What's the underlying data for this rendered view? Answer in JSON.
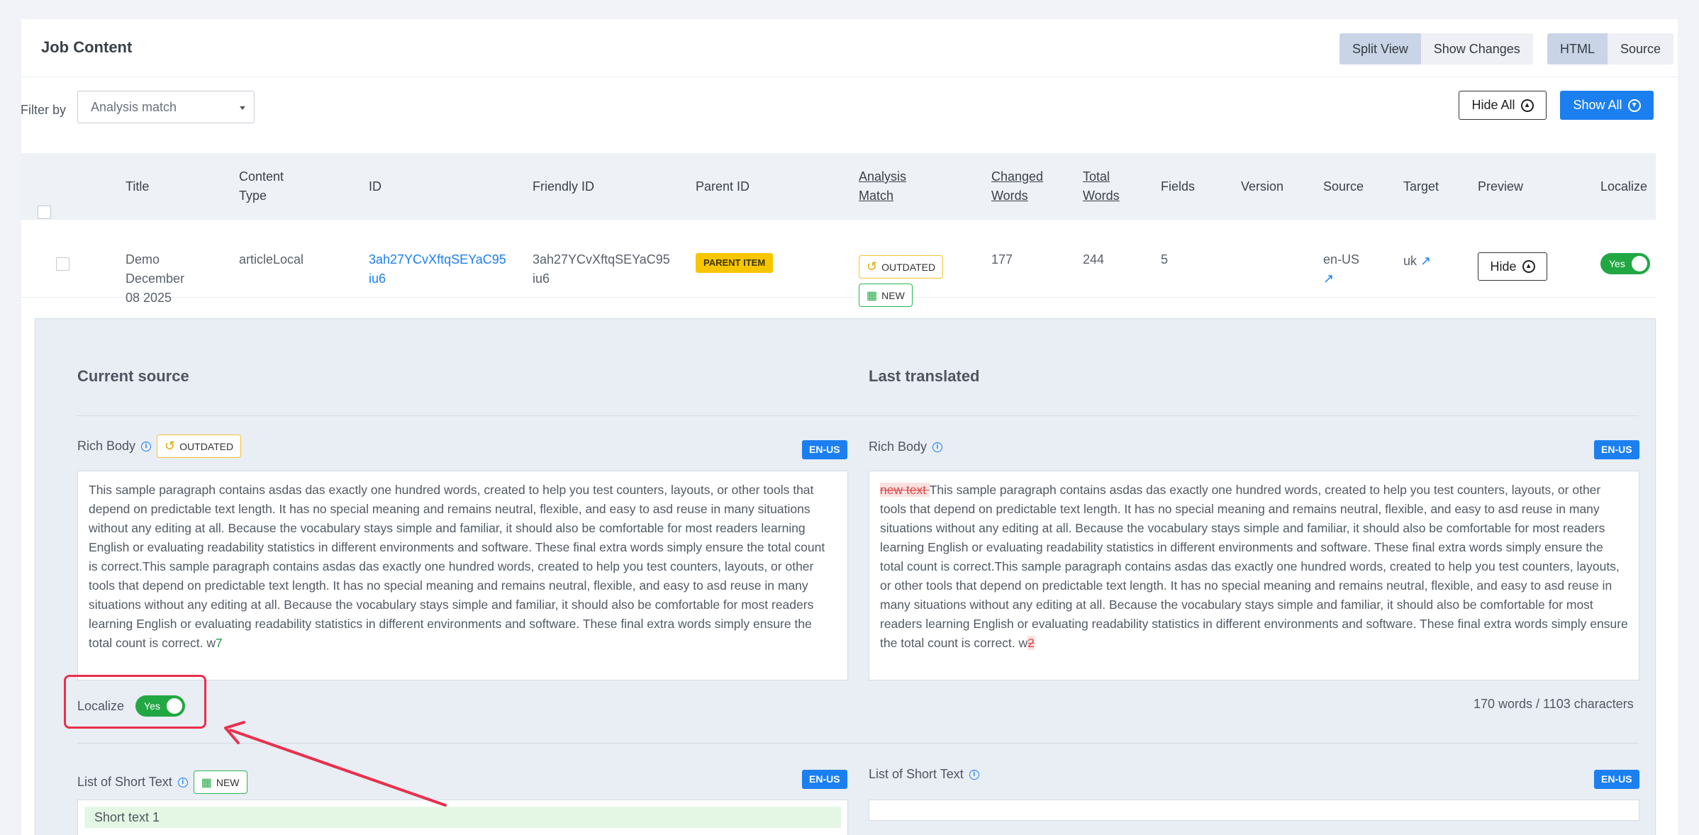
{
  "header": {
    "title": "Job Content",
    "view_options": [
      "Split View",
      "Show Changes"
    ],
    "mode_options": [
      "HTML",
      "Source"
    ]
  },
  "filter": {
    "label": "Filter by",
    "selected": "Analysis match",
    "hide_all": "Hide All",
    "show_all": "Show All"
  },
  "table": {
    "columns": [
      "Title",
      "Content Type",
      "ID",
      "Friendly ID",
      "Parent ID",
      "Analysis Match",
      "Changed Words",
      "Total Words",
      "Fields",
      "Version",
      "Source",
      "Target",
      "Preview",
      "Localize"
    ],
    "row": {
      "title": "Demo December 08 2025",
      "content_type": "articleLocal",
      "id": "3ah27YCvXftqSEYaC95iu6",
      "friendly_id": "3ah27YCvXftqSEYaC95iu6",
      "parent_badge": "PARENT ITEM",
      "badge_outdated": "OUTDATED",
      "badge_new": "NEW",
      "changed_words": "177",
      "total_words": "244",
      "fields": "5",
      "version": "",
      "source": "en-US",
      "target": "uk",
      "preview_button": "Hide",
      "localize_toggle": "Yes"
    }
  },
  "panel": {
    "current_source_title": "Current source",
    "last_translated_title": "Last translated",
    "rich_body": {
      "label": "Rich Body",
      "badge": "OUTDATED",
      "lang": "EN-US",
      "source_text": "This sample paragraph contains asdas das exactly one hundred words, created to help you test counters, layouts, or other tools that depend on predictable text length. It has no special meaning and remains neutral, flexible, and easy to asd reuse in many situations without any editing at all. Because the vocabulary stays simple and familiar, it should also be comfortable for most readers learning English or evaluating readability statistics in different environments and software. These final extra words simply ensure the total count is correct.This sample paragraph contains asdas das exactly one hundred words, created to help you test counters, layouts, or other tools that depend on predictable text length. It has no special meaning and remains neutral, flexible, and easy to asd reuse in many situations without any editing at all. Because the vocabulary stays simple and familiar, it should also be comfortable for most readers learning English or evaluating readability statistics in different environments and software. These final extra words simply ensure the total count is correct. w",
      "source_inserted": "7",
      "translated_deleted": "new text ",
      "translated_text": "This sample paragraph contains asdas das exactly one hundred words, created to help you test counters, layouts, or other tools that depend on predictable text length. It has no special meaning and remains neutral, flexible, and easy to asd reuse in many situations without any editing at all. Because the vocabulary stays simple and familiar, it should also be comfortable for most readers learning English or evaluating readability statistics in different environments and software. These final extra words simply ensure the total count is correct.This sample paragraph contains asdas das exactly one hundred words, created to help you test counters, layouts, or other tools that depend on predictable text length. It has no special meaning and remains neutral, flexible, and easy to asd reuse in many situations without any editing at all. Because the vocabulary stays simple and familiar, it should also be comfortable for most readers learning English or evaluating readability statistics in different environments and software. These final extra words simply ensure the total count is correct. w",
      "translated_deleted_end": "2",
      "word_count": "170 words / 1103 characters"
    },
    "localize": {
      "label": "Localize",
      "toggle": "Yes"
    },
    "short_text": {
      "label": "List of Short Text",
      "badge": "NEW",
      "lang": "EN-US",
      "items": [
        "Short text 1"
      ]
    }
  },
  "colors": {
    "accent": "#1b7ff0",
    "success": "#22a843",
    "warning": "#f7c600",
    "annotation": "#e8304c"
  }
}
